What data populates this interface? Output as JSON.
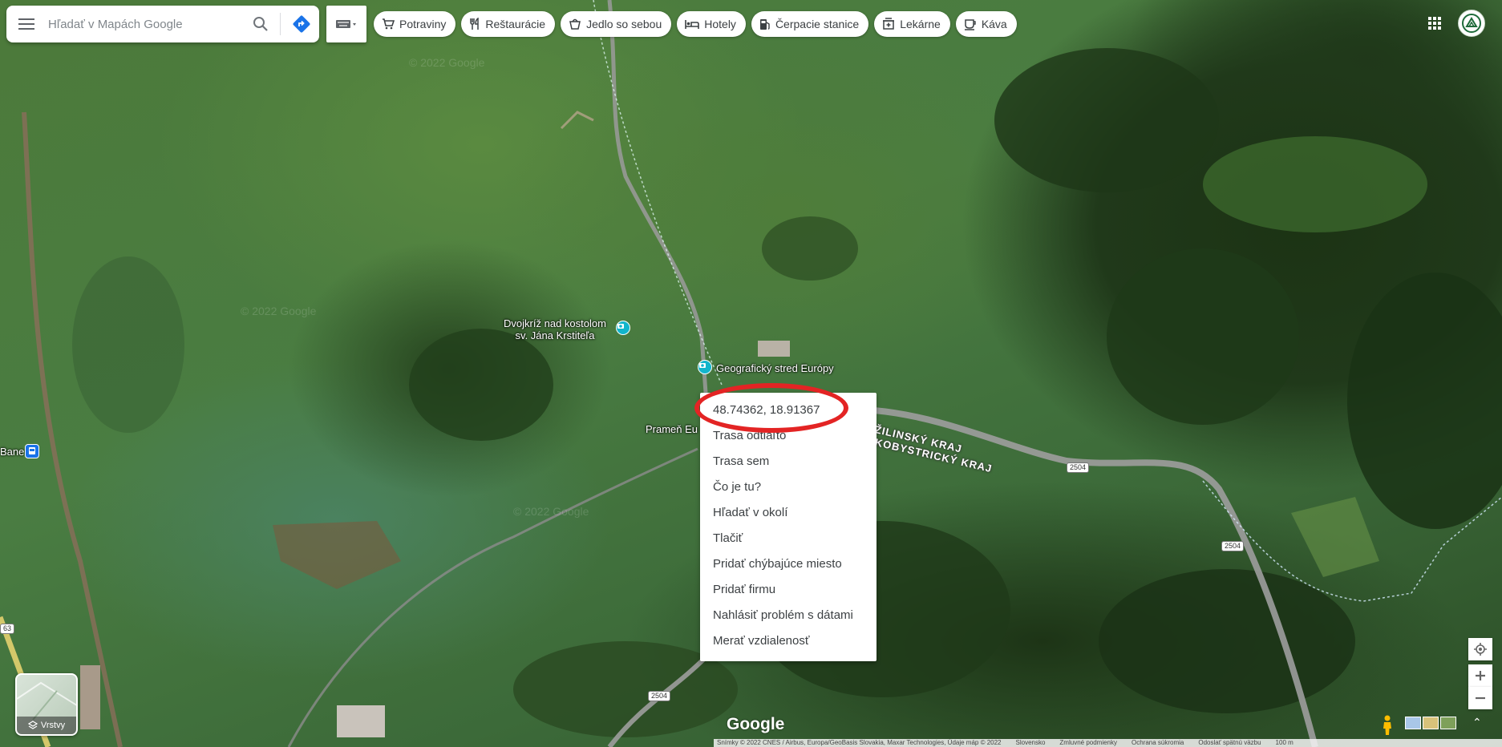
{
  "search": {
    "placeholder": "Hľadať v Mapách Google"
  },
  "chips": [
    {
      "icon": "cart-icon",
      "label": "Potraviny"
    },
    {
      "icon": "cutlery-icon",
      "label": "Reštaurácie"
    },
    {
      "icon": "takeout-icon",
      "label": "Jedlo so sebou"
    },
    {
      "icon": "bed-icon",
      "label": "Hotely"
    },
    {
      "icon": "gas-station-icon",
      "label": "Čerpacie stanice"
    },
    {
      "icon": "pharmacy-icon",
      "label": "Lekárne"
    },
    {
      "icon": "coffee-icon",
      "label": "Káva"
    }
  ],
  "map_labels": {
    "poi_cross": "Dvojkríž nad kostolom\nsv. Jána Krstiteľa",
    "poi_center": "Geografický stred Európy",
    "poi_spring": "Prameň Eu",
    "poi_station": "Bane",
    "region_1": "ŽILINSKÝ KRAJ",
    "region_2": "KOBYSTRICKÝ KRAJ",
    "road_1": "2504",
    "road_2": "2504",
    "road_3": "2504",
    "road_4": "63",
    "watermark": "© 2022 Google"
  },
  "context_menu": {
    "items": [
      "48.74362, 18.91367",
      "Trasa odtiaľto",
      "Trasa sem",
      "Čo je tu?",
      "Hľadať v okolí",
      "Tlačiť",
      "Pridať chýbajúce miesto",
      "Pridať firmu",
      "Nahlásiť problém s dátami",
      "Merať vzdialenosť"
    ]
  },
  "layers": {
    "label": "Vrstvy"
  },
  "logo": "Google",
  "footer": {
    "attribution": "Snímky © 2022 CNES / Airbus, Europa/GeoBasis Slovakia, Maxar Technologies, Údaje máp © 2022",
    "country": "Slovensko",
    "terms": "Zmluvné podmienky",
    "privacy": "Ochrana súkromia",
    "feedback": "Odoslať spätnú väzbu",
    "scale": "100 m"
  },
  "colors": {
    "accent": "#1a73e8",
    "annotation": "#e32424",
    "poi": "#12b5cb"
  }
}
